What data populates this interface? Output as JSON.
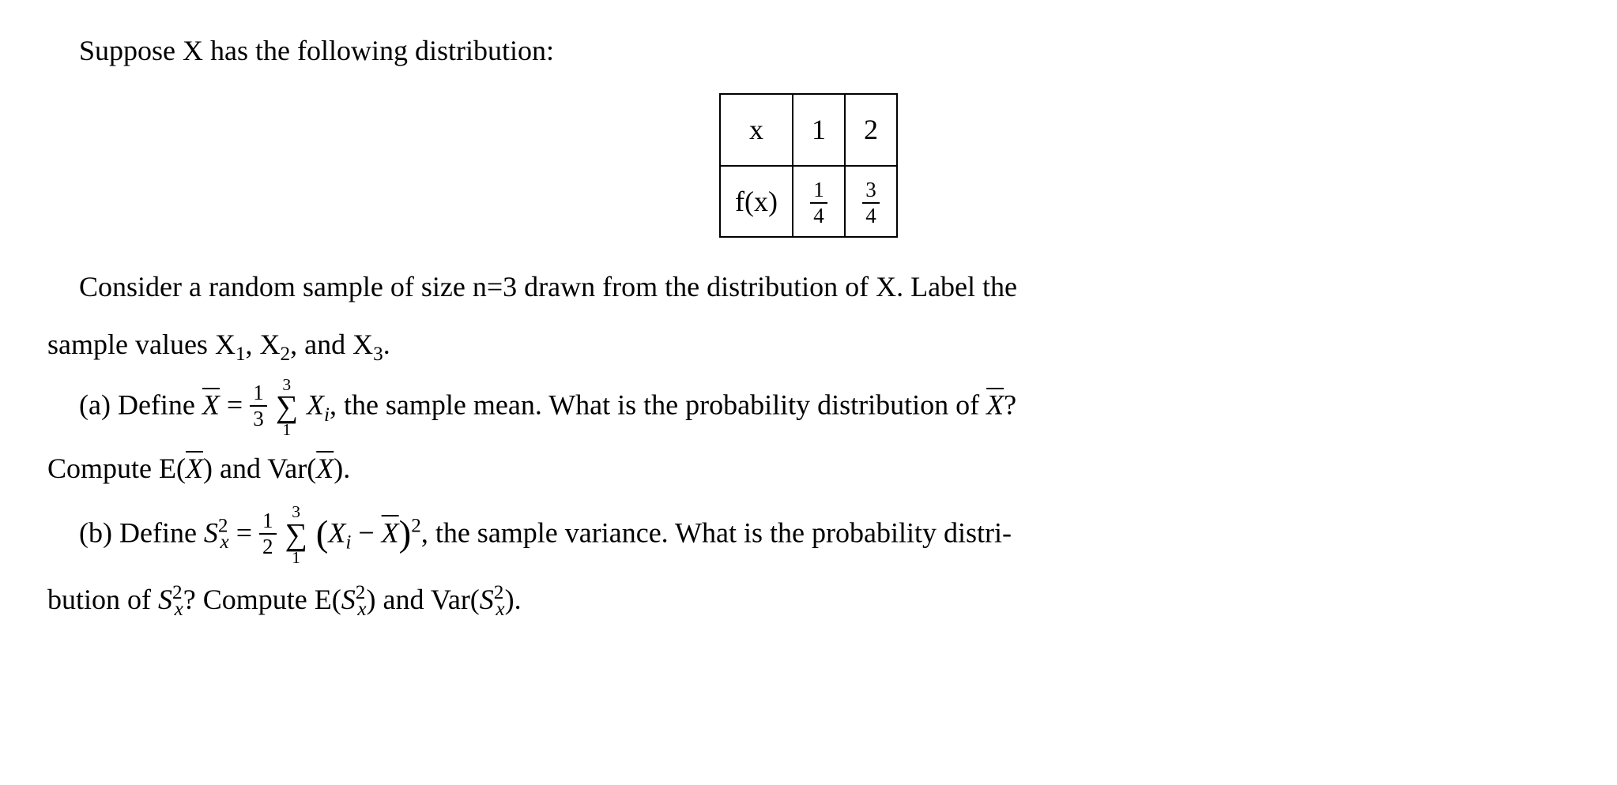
{
  "intro": "Suppose X has the following distribution:",
  "table": {
    "r1c1": "x",
    "r1c2": "1",
    "r1c3": "2",
    "r2c1": "f(x)",
    "r2c2_num": "1",
    "r2c2_den": "4",
    "r2c3_num": "3",
    "r2c3_den": "4"
  },
  "para2a": "Consider a random sample of size n=3 drawn from the distribution of X. Label the",
  "para2b_prefix": "sample values X",
  "para2b_mid1": ", X",
  "para2b_mid2": ", and X",
  "para2b_suffix": ".",
  "sub1": "1",
  "sub2": "2",
  "sub3": "3",
  "a_label": "(a) Define ",
  "xbar": "X",
  "eq": " = ",
  "one_third_num": "1",
  "one_third_den": "3",
  "sum_upper": "3",
  "sum_lower": "1",
  "a_aftersum": " X",
  "sub_i": "i",
  "a_tail": ", the sample mean. What is the probability distribution of ",
  "a_tail2": "?",
  "a_line2a": "Compute E(",
  "a_line2b": ") and Var(",
  "a_line2c": ").",
  "b_label": "(b) Define ",
  "b_S": "S",
  "b_x": "x",
  "b_sq": "2",
  "one_half_num": "1",
  "one_half_den": "2",
  "b_in_paren_a": "X",
  "b_minus": " − ",
  "b_tail": ", the sample variance. What is the probability distri-",
  "b_line2a": "bution of ",
  "b_line2b": "? Compute E(",
  "b_line2c": ") and Var(",
  "b_line2d": ")."
}
